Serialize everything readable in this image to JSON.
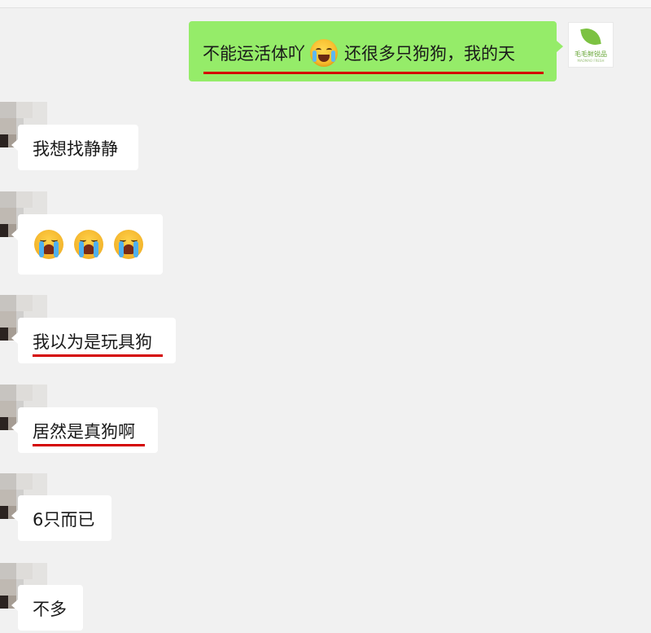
{
  "outgoing": {
    "text_before": "不能运活体吖",
    "emoji": "laughing-crying-emoji",
    "text_after": "还很多只狗狗，我的天",
    "avatar": {
      "brand": "毛毛鲜锐品",
      "subtitle": "MAOMAO FRESH",
      "accent": "#7cc242"
    },
    "bubble_color": "#95ec69",
    "underline_color": "#d40000"
  },
  "incoming": [
    {
      "type": "text",
      "text": "我想找静静"
    },
    {
      "type": "emoji",
      "emojis": [
        "crying-face-emoji",
        "crying-face-emoji",
        "crying-face-emoji"
      ]
    },
    {
      "type": "text",
      "text": "我以为是玩具狗",
      "underlined": true
    },
    {
      "type": "text",
      "text": "居然是真狗啊",
      "underlined": true
    },
    {
      "type": "text",
      "text": "6只而已"
    },
    {
      "type": "text",
      "text": "不多"
    }
  ]
}
